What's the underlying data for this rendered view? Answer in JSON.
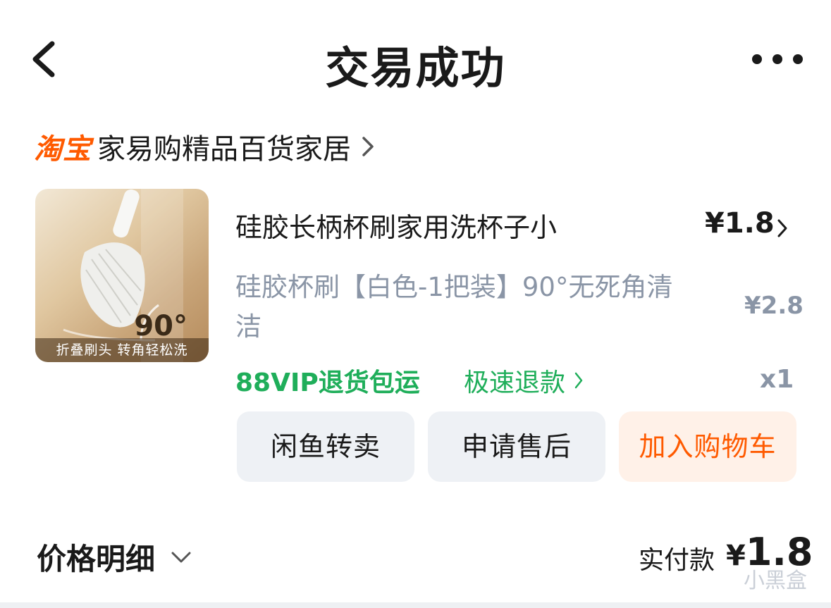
{
  "header": {
    "title": "交易成功"
  },
  "shop": {
    "platform": "淘宝",
    "name": "家易购精品百货家居"
  },
  "product": {
    "title": "硅胶长柄杯刷家用洗杯子小",
    "price": "¥1.8",
    "spec": "硅胶杯刷【白色-1把装】90°无死角清洁",
    "original_price": "¥2.8",
    "quantity": "x1",
    "thumbnail": {
      "angle_text": "90°",
      "caption": "折叠刷头 转角轻松洗"
    },
    "tags": {
      "vip": "88VIP退货包运",
      "fast_refund": "极速退款"
    }
  },
  "actions": {
    "resell": "闲鱼转卖",
    "after_sale": "申请售后",
    "add_cart": "加入购物车"
  },
  "summary": {
    "detail_label": "价格明细",
    "paid_label": "实付款",
    "paid_currency": "¥",
    "paid_amount": "1.8"
  },
  "watermark": "小黑盒",
  "colors": {
    "brand_orange": "#ff5a00",
    "green": "#1fae5a",
    "muted": "#8a95a6",
    "button_gray": "#eef1f5",
    "cart_bg": "#fff1e8"
  },
  "icons": [
    "back-icon",
    "more-icon",
    "chevron-right-icon",
    "chevron-down-icon"
  ]
}
